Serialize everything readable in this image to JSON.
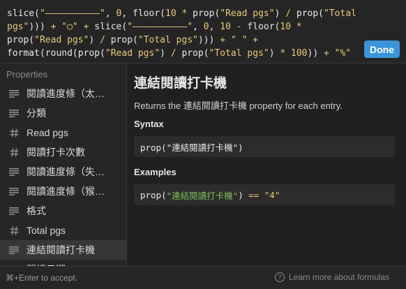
{
  "editor": {
    "lines": [
      [
        {
          "t": "slice(",
          "k": "plain"
        },
        {
          "t": "\"——————————\"",
          "k": "str"
        },
        {
          "t": ", ",
          "k": "plain"
        },
        {
          "t": "0",
          "k": "num"
        },
        {
          "t": ", floor(",
          "k": "plain"
        },
        {
          "t": "10",
          "k": "num"
        },
        {
          "t": " * ",
          "k": "op"
        },
        {
          "t": "prop(",
          "k": "plain"
        },
        {
          "t": "\"Read pgs\"",
          "k": "str"
        },
        {
          "t": ") ",
          "k": "plain"
        },
        {
          "t": "/",
          "k": "op"
        },
        {
          "t": " prop(",
          "k": "plain"
        },
        {
          "t": "\"Total",
          "k": "str"
        }
      ],
      [
        {
          "t": "pgs\"",
          "k": "str"
        },
        {
          "t": "))) ",
          "k": "plain"
        },
        {
          "t": "+",
          "k": "op"
        },
        {
          "t": " ",
          "k": "plain"
        },
        {
          "t": "\"◯\"",
          "k": "str"
        },
        {
          "t": " ",
          "k": "plain"
        },
        {
          "t": "+",
          "k": "op"
        },
        {
          "t": " slice(",
          "k": "plain"
        },
        {
          "t": "\"——————————\"",
          "k": "str"
        },
        {
          "t": ", ",
          "k": "plain"
        },
        {
          "t": "0",
          "k": "num"
        },
        {
          "t": ", ",
          "k": "plain"
        },
        {
          "t": "10",
          "k": "num"
        },
        {
          "t": " - ",
          "k": "op"
        },
        {
          "t": "floor(",
          "k": "plain"
        },
        {
          "t": "10",
          "k": "num"
        },
        {
          "t": " *",
          "k": "op"
        }
      ],
      [
        {
          "t": "prop(",
          "k": "plain"
        },
        {
          "t": "\"Read pgs\"",
          "k": "str"
        },
        {
          "t": ") ",
          "k": "plain"
        },
        {
          "t": "/",
          "k": "op"
        },
        {
          "t": " prop(",
          "k": "plain"
        },
        {
          "t": "\"Total pgs\"",
          "k": "str"
        },
        {
          "t": "))) ",
          "k": "plain"
        },
        {
          "t": "+",
          "k": "op"
        },
        {
          "t": " ",
          "k": "plain"
        },
        {
          "t": "\" \"",
          "k": "str"
        },
        {
          "t": " ",
          "k": "plain"
        },
        {
          "t": "+",
          "k": "op"
        }
      ],
      [
        {
          "t": "format(round(prop(",
          "k": "plain"
        },
        {
          "t": "\"Read pgs\"",
          "k": "str"
        },
        {
          "t": ") ",
          "k": "plain"
        },
        {
          "t": "/",
          "k": "op"
        },
        {
          "t": " prop(",
          "k": "plain"
        },
        {
          "t": "\"Total pgs\"",
          "k": "str"
        },
        {
          "t": ") ",
          "k": "plain"
        },
        {
          "t": "*",
          "k": "op"
        },
        {
          "t": " ",
          "k": "plain"
        },
        {
          "t": "100",
          "k": "num"
        },
        {
          "t": ")) ",
          "k": "plain"
        },
        {
          "t": "+",
          "k": "op"
        },
        {
          "t": " ",
          "k": "plain"
        },
        {
          "t": "\"%\"",
          "k": "str"
        }
      ]
    ]
  },
  "done_label": "Done",
  "sidebar": {
    "title": "Properties",
    "items": [
      {
        "label": "閱讀進度條（太…",
        "icon": "text-lines-icon",
        "glyph": "lines"
      },
      {
        "label": "分類",
        "icon": "text-lines-icon",
        "glyph": "lines"
      },
      {
        "label": "Read pgs",
        "icon": "hash-icon",
        "glyph": "hash"
      },
      {
        "label": "閱讀打卡次數",
        "icon": "hash-icon",
        "glyph": "hash"
      },
      {
        "label": "閱讀進度條（失…",
        "icon": "text-lines-icon",
        "glyph": "lines"
      },
      {
        "label": "閱讀進度條（猴…",
        "icon": "text-lines-icon",
        "glyph": "lines"
      },
      {
        "label": "格式",
        "icon": "text-lines-icon",
        "glyph": "lines"
      },
      {
        "label": "Total pgs",
        "icon": "hash-icon",
        "glyph": "hash"
      },
      {
        "label": "連結閱讀打卡機",
        "icon": "text-lines-icon",
        "glyph": "lines",
        "selected": true
      },
      {
        "label": "閱讀日期",
        "icon": "text-lines-icon",
        "glyph": "lines"
      }
    ]
  },
  "detail": {
    "title": "連結閱讀打卡機",
    "desc_prefix": "Returns the ",
    "desc_name": "連結閱讀打卡機",
    "desc_suffix": " property for each entry.",
    "syntax_label": "Syntax",
    "syntax_code": [
      {
        "t": "prop(\"連結閱讀打卡機\")",
        "k": "plain"
      }
    ],
    "examples_label": "Examples",
    "example_code": [
      {
        "t": "prop(",
        "k": "plain"
      },
      {
        "t": "\"連結閱讀打卡機\"",
        "k": "str"
      },
      {
        "t": ") ",
        "k": "plain"
      },
      {
        "t": "==",
        "k": "op"
      },
      {
        "t": " ",
        "k": "plain"
      },
      {
        "t": "\"4\"",
        "k": "op"
      }
    ]
  },
  "footer": {
    "hint": "⌘+Enter to accept.",
    "help_icon": "question-circle-icon",
    "help_symbol": "?",
    "help_link": "Learn more about formulas"
  }
}
